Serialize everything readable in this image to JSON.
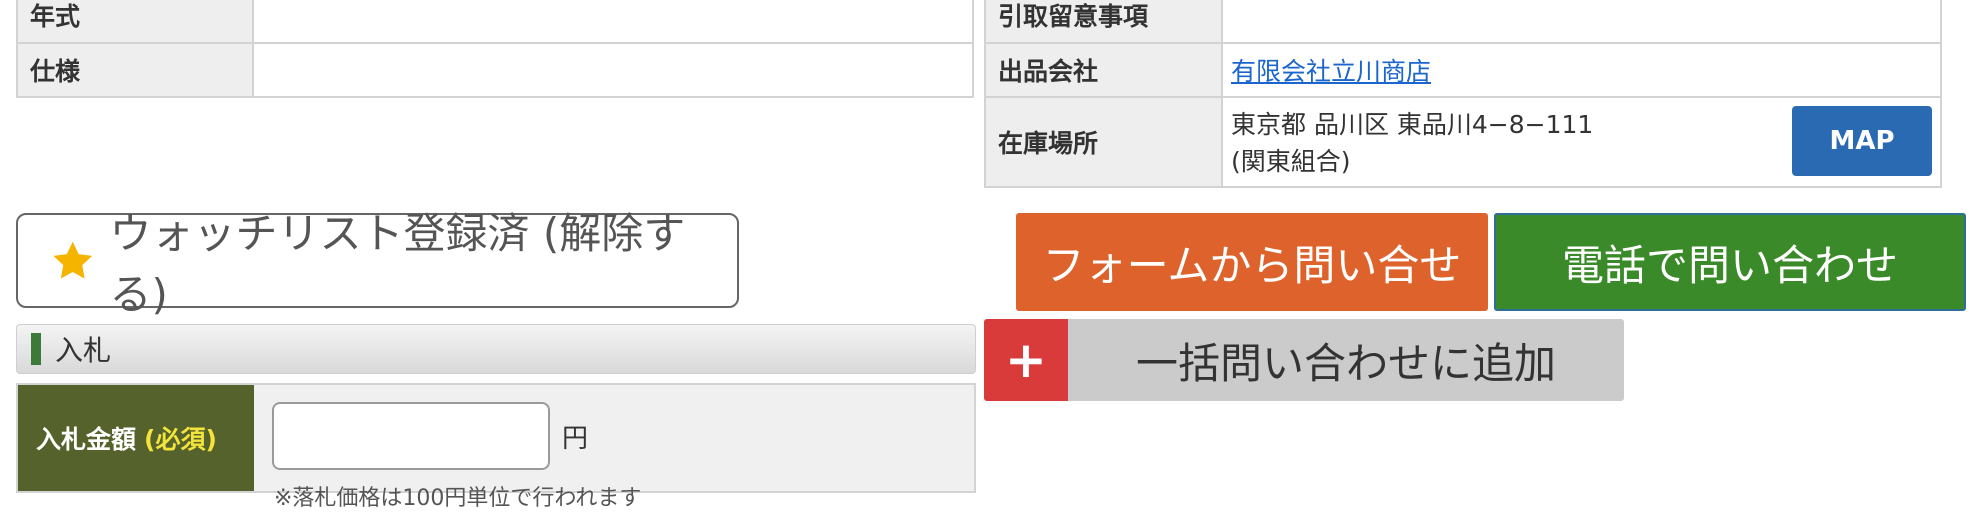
{
  "left_table": {
    "rows": [
      {
        "label": "年式",
        "value": ""
      },
      {
        "label": "仕様",
        "value": ""
      }
    ]
  },
  "right_table": {
    "handling_label": "引取留意事項",
    "handling_value": "",
    "company_label": "出品会社",
    "company_name": "有限会社立川商店",
    "location_label": "在庫場所",
    "location_address": "東京都 品川区 東品川4−8−111",
    "location_union": "(関東組合)",
    "map_button": "MAP"
  },
  "watchlist": {
    "label": "ウォッチリスト登録済 (解除する)",
    "icon": "star-icon"
  },
  "contact": {
    "form_button": "フォームから問い合せ",
    "tel_button": "電話で問い合わせ"
  },
  "bulk": {
    "plus": "+",
    "label": "一括問い合わせに追加"
  },
  "bid": {
    "section_title": "入札",
    "amount_label": "入札金額",
    "required": "(必須)",
    "input_value": "",
    "input_placeholder": "",
    "unit": "円",
    "note": "※落札価格は100円単位で行われます"
  },
  "colors": {
    "form_button": "#dd622b",
    "tel_button": "#3a8a2a",
    "map_button": "#2a6ab2",
    "plus_box": "#d93a3a",
    "bid_label_bg": "#56622c",
    "required_text": "#f3e43b",
    "star": "#f5b400"
  }
}
